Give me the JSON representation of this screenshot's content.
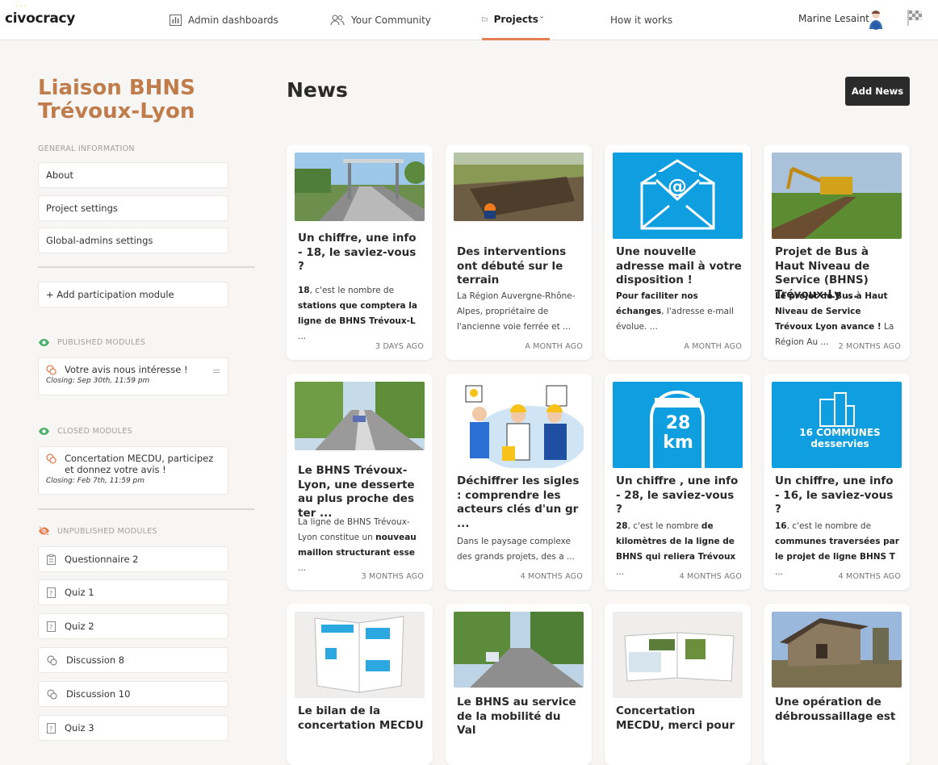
{
  "topbar": {
    "logo": "civocracy",
    "nav": [
      {
        "label": "Admin dashboards",
        "icon": "bar-chart-icon"
      },
      {
        "label": "Your Community",
        "icon": "people-icon"
      },
      {
        "label": "Projects",
        "icon": "folder-icon"
      },
      {
        "label": "How it works"
      }
    ],
    "user_name": "Marine Lesaint"
  },
  "colors": {
    "accent": "#e67e54",
    "title": "#c07d4b",
    "dark_button": "#2b2b2b",
    "blue": "#0f9fe0"
  },
  "sidebar": {
    "project_title": "Liaison BHNS Trévoux-Lyon",
    "general_heading": "GENERAL INFORMATION",
    "general_items": [
      "About",
      "Project settings",
      "Global-admins settings"
    ],
    "add_module": "+ Add participation module",
    "published_heading": "PUBLISHED MODULES",
    "published": [
      {
        "title": "Votre avis nous intéresse !",
        "closing": "Closing: Sep 30th, 11:59 pm"
      }
    ],
    "closed_heading": "CLOSED MODULES",
    "closed": [
      {
        "title": "Concertation MECDU, participez et donnez votre avis !",
        "closing": "Closing: Feb 7th, 11:59 pm"
      }
    ],
    "unpublished_heading": "UNPUBLISHED MODULES",
    "unpublished": [
      {
        "label": "Questionnaire 2",
        "icon": "clipboard-icon"
      },
      {
        "label": "Quiz 1",
        "icon": "quiz-icon"
      },
      {
        "label": "Quiz 2",
        "icon": "quiz-icon"
      },
      {
        "label": "Discussion 8",
        "icon": "chat-icon"
      },
      {
        "label": "Discussion 10",
        "icon": "chat-icon"
      },
      {
        "label": "Quiz 3",
        "icon": "quiz-icon"
      }
    ]
  },
  "main": {
    "title": "News",
    "add_button": "Add News",
    "cards": [
      {
        "title": "Un chiffre, une info - 18, le saviez-vous ?",
        "excerpt_html": "<b>18</b>, c'est le nombre de <b>stations que comptera la ligne de BHNS Trévoux-L</b> ...",
        "date": "3 DAYS AGO"
      },
      {
        "title": "Des interventions ont débuté sur le terrain",
        "excerpt_html": "La Région Auvergne-Rhône-Alpes, propriétaire de l'ancienne voie ferrée et ...",
        "date": "A MONTH AGO"
      },
      {
        "title": "Une nouvelle adresse mail à votre disposition !",
        "excerpt_html": "<b>Pour faciliter nos échanges</b>, l'adresse e-mail évolue.  ...",
        "date": "A MONTH AGO"
      },
      {
        "title": "Projet de Bus à Haut Niveau de Service (BHNS) Trévoux-Ly ...",
        "excerpt_html": "<b>Le projet de Bus à Haut Niveau de Service Trévoux Lyon avance !</b> La Région Au ...",
        "date": "2 MONTHS AGO"
      },
      {
        "title": "Le BHNS Trévoux-Lyon, une desserte au plus proche des ter ...",
        "excerpt_html": "La ligne de BHNS Trévoux-Lyon constitue un <b>nouveau maillon structurant esse</b> ...",
        "date": "3 MONTHS AGO"
      },
      {
        "title": "Déchiffrer les sigles : comprendre les acteurs clés d'un gr ...",
        "excerpt_html": "Dans le paysage complexe des grands projets, des a ...",
        "date": "4 MONTHS AGO"
      },
      {
        "title": "Un chiffre , une info - 28, le saviez-vous ?",
        "excerpt_html": "<b>28</b>, c'est le nombre <b>de kilomètres de la ligne de BHNS qui reliera Trévoux</b> ...",
        "date": "4 MONTHS AGO",
        "image_text": "28 km"
      },
      {
        "title": "Un chiffre, une info - 16, le saviez-vous ?",
        "excerpt_html": "<b>16</b>, c'est le nombre de <b>communes traversées par le projet de ligne BHNS T</b> ...",
        "date": "4 MONTHS AGO",
        "image_text": "16 COMMUNES desservies"
      },
      {
        "title": "Le bilan de la concertation MECDU",
        "excerpt_html": "",
        "date": ""
      },
      {
        "title": "Le BHNS au service de la mobilité du Val",
        "excerpt_html": "",
        "date": ""
      },
      {
        "title": "Concertation MECDU, merci pour",
        "excerpt_html": "",
        "date": ""
      },
      {
        "title": "Une opération de débroussaillage est",
        "excerpt_html": "",
        "date": ""
      }
    ]
  }
}
